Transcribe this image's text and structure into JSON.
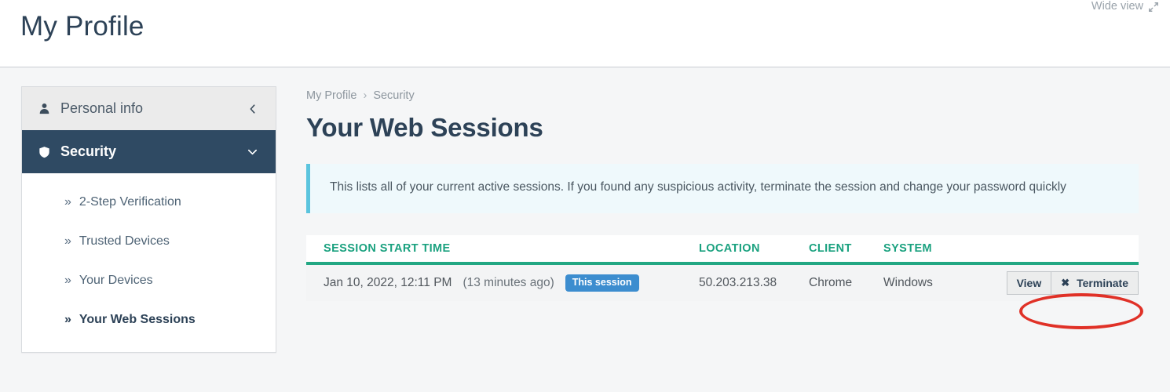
{
  "header": {
    "title": "My Profile",
    "wide_view_label": "Wide view",
    "wide_view_icon": "expand-arrows-icon"
  },
  "sidebar": {
    "primary_items": [
      {
        "label": "Personal info",
        "icon": "user-icon",
        "chevron": "chevron-left-icon",
        "active": false
      },
      {
        "label": "Security",
        "icon": "shield-icon",
        "chevron": "chevron-down-icon",
        "active": true
      }
    ],
    "sub_items": [
      {
        "label": "2-Step Verification",
        "marker": "»",
        "active": false
      },
      {
        "label": "Trusted Devices",
        "marker": "»",
        "active": false
      },
      {
        "label": "Your Devices",
        "marker": "»",
        "active": false
      },
      {
        "label": "Your Web Sessions",
        "marker": "»",
        "active": true
      }
    ]
  },
  "main": {
    "breadcrumb": {
      "root": "My Profile",
      "separator": "›",
      "current": "Security"
    },
    "section_title": "Your Web Sessions",
    "alert_text": "This lists all of your current active sessions. If you found any suspicious activity, terminate the session and change your password quickly",
    "table": {
      "columns": [
        "SESSION START TIME",
        "LOCATION",
        "CLIENT",
        "SYSTEM"
      ],
      "rows": [
        {
          "start_time": "Jan 10, 2022, 12:11 PM",
          "relative_time": "(13 minutes ago)",
          "badge": "This session",
          "location": "50.203.213.38",
          "client": "Chrome",
          "system": "Windows",
          "actions": [
            {
              "label": "View",
              "icon": null
            },
            {
              "label": "Terminate",
              "icon": "close-x-icon"
            }
          ]
        }
      ]
    }
  },
  "annotation": {
    "shape": "ellipse",
    "color": "#e03127",
    "target": "terminate-button"
  },
  "colors": {
    "accent_teal": "#1aa17f",
    "sidebar_active": "#2f4a63",
    "badge_blue": "#3c8dcf",
    "alert_border": "#5bc4de",
    "alert_bg": "#eff9fc",
    "annotation_red": "#e03127",
    "title_navy": "#2d4257"
  }
}
